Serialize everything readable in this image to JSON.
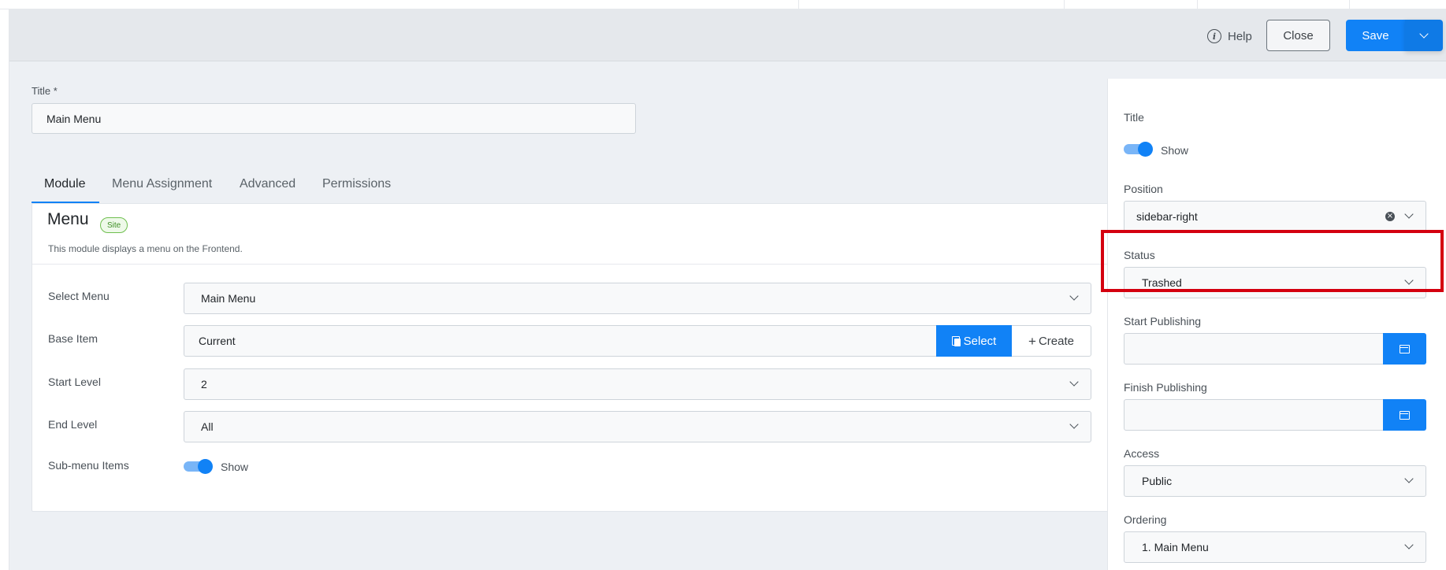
{
  "toolbar": {
    "help_label": "Help",
    "close_label": "Close",
    "save_label": "Save"
  },
  "title_field": {
    "label": "Title *",
    "value": "Main Menu"
  },
  "tabs": [
    {
      "label": "Module"
    },
    {
      "label": "Menu Assignment"
    },
    {
      "label": "Advanced"
    },
    {
      "label": "Permissions"
    }
  ],
  "module": {
    "title": "Menu",
    "badge": "Site",
    "description": "This module displays a menu on the Frontend.",
    "fields": {
      "select_menu": {
        "label": "Select Menu",
        "value": "Main Menu"
      },
      "base_item": {
        "label": "Base Item",
        "value": "Current",
        "select_label": "Select",
        "create_label": "Create"
      },
      "start_level": {
        "label": "Start Level",
        "value": "2"
      },
      "end_level": {
        "label": "End Level",
        "value": "All"
      },
      "submenu_items": {
        "label": "Sub-menu Items",
        "toggle_label": "Show"
      }
    }
  },
  "side": {
    "title": {
      "label": "Title",
      "toggle_label": "Show"
    },
    "position": {
      "label": "Position",
      "value": "sidebar-right"
    },
    "status": {
      "label": "Status",
      "value": "Trashed"
    },
    "start_publishing": {
      "label": "Start Publishing",
      "value": ""
    },
    "finish_publishing": {
      "label": "Finish Publishing",
      "value": ""
    },
    "access": {
      "label": "Access",
      "value": "Public"
    },
    "ordering": {
      "label": "Ordering",
      "value": "1. Main Menu"
    }
  },
  "colors": {
    "primary": "#1182f6",
    "highlight": "#d4000f",
    "badge_green": "#3e8e25"
  }
}
